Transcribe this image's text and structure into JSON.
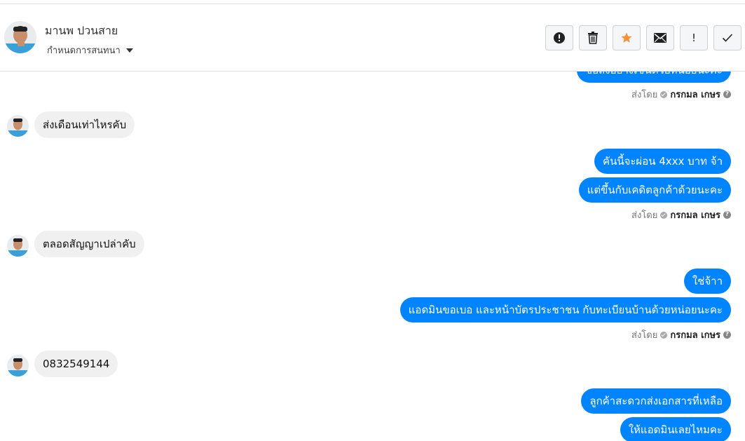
{
  "header": {
    "contact_name": "มานพ ปวนสาย",
    "assign_label": "กำหนดการสนทนา",
    "actions": [
      {
        "icon": "alert-circle-icon"
      },
      {
        "icon": "trash-icon"
      },
      {
        "icon": "star-icon",
        "color": "#f5923e"
      },
      {
        "icon": "envelope-icon"
      },
      {
        "icon": "exclamation-icon",
        "text": "!"
      },
      {
        "icon": "checkmark-icon"
      }
    ]
  },
  "messages": {
    "out_1": "ขอส่งอย่างเช่นด้วยหน่อยนะคะ",
    "in_1": "ส่งเดือนเท่าไหรคับ",
    "out_2": "คันนี้จะผ่อน 4xxx บาท จ้า",
    "out_3": "แต่ขึ้นกับเคดิตลูกค้าด้วยนะคะ",
    "in_2": "ตลอดสัญญาเปล่าคับ",
    "out_4": "ใช่จ้าา",
    "out_5": "แอดมินขอเบอ และหน้าบัตรประชาชน กับทะเบียนบ้านด้วยหน่อยนะคะ",
    "in_3": "0832549144",
    "out_6": "ลูกค้าสะดวกส่งเอกสารที่เหลือ",
    "out_7": "ให้แอดมินเลยไหมคะ"
  },
  "sent_by": {
    "prefix": "ส่งโดย",
    "name": "กรกมล เกษร",
    "help": "?"
  },
  "colors": {
    "outgoing_bubble": "#0084ff",
    "incoming_bubble": "#f0f0f0",
    "star": "#f5923e"
  }
}
